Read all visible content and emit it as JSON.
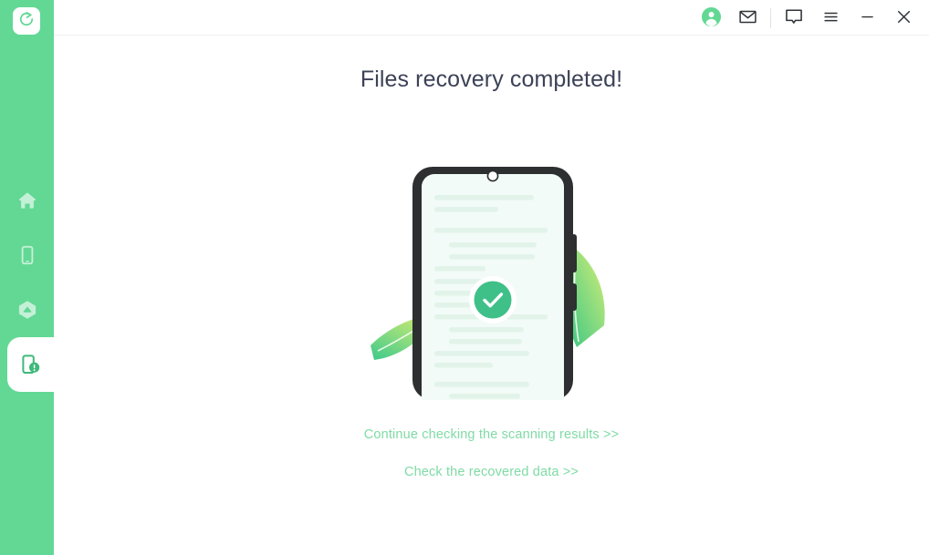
{
  "app": {
    "logo_icon": "restore-refresh-icon",
    "accent_green": "#62d894",
    "link_green": "#7fdba5",
    "title_color": "#3c4257",
    "phone_frame_color": "#2d2f31",
    "screen_color": "#f2fbf7"
  },
  "sidebar": {
    "items": [
      {
        "name": "home",
        "icon": "home-icon",
        "active": false
      },
      {
        "name": "device",
        "icon": "phone-icon",
        "active": false
      },
      {
        "name": "backup",
        "icon": "cloud-backup-icon",
        "active": false
      },
      {
        "name": "recovery",
        "icon": "phone-alert-icon",
        "active": true
      }
    ]
  },
  "titlebar": {
    "buttons": [
      {
        "name": "account",
        "icon": "user-avatar-icon"
      },
      {
        "name": "mail",
        "icon": "envelope-icon"
      },
      {
        "name": "feedback",
        "icon": "speech-bubble-icon"
      },
      {
        "name": "menu",
        "icon": "hamburger-menu-icon"
      },
      {
        "name": "minimize",
        "icon": "minimize-icon"
      },
      {
        "name": "close",
        "icon": "close-icon"
      }
    ]
  },
  "main": {
    "title": "Files recovery completed!",
    "illustration": {
      "name": "phone-recovery-success-illustration",
      "status_icon": "check-circle-icon"
    },
    "links": [
      {
        "label": "Continue checking the scanning results >>",
        "name": "continue-scanning-results-link"
      },
      {
        "label": "Check the recovered data >>",
        "name": "check-recovered-data-link"
      }
    ]
  }
}
